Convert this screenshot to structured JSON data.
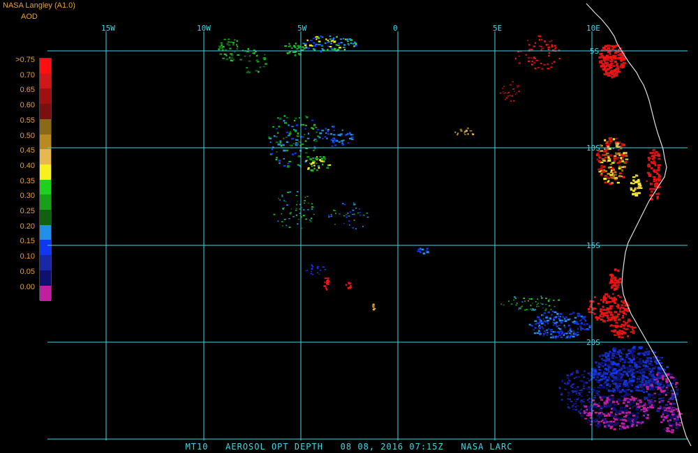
{
  "header": {
    "title": "NASA Langley (A1.0)",
    "product": "AOD"
  },
  "legend": {
    "labels": [
      ">0.75",
      "0.70",
      "0.65",
      "0.60",
      "0.55",
      "0.50",
      "0.45",
      "0.40",
      "0.35",
      "0.30",
      "0.25",
      "0.20",
      "0.15",
      "0.10",
      "0.05",
      "0.00"
    ],
    "colors": [
      "#ff1010",
      "#d01818",
      "#a01010",
      "#7a1010",
      "#8a6a18",
      "#b88a20",
      "#e8b850",
      "#f8f020",
      "#20d020",
      "#18a018",
      "#106010",
      "#2090e8",
      "#1038f0",
      "#1828a8",
      "#101070",
      "#c020a0"
    ]
  },
  "map": {
    "lon_labels": [
      "15W",
      "10W",
      "5W",
      "0",
      "5E",
      "10E"
    ],
    "lat_labels": [
      "5S",
      "10S",
      "15S",
      "20S"
    ],
    "grid_color": "#40d8e8",
    "coast_color": "#e0e0e0"
  },
  "footer": {
    "sat": "MT10",
    "product_name": "AEROSOL OPT DEPTH",
    "datetime": "08 08, 2016 07:15Z",
    "source": "NASA LARC"
  }
}
